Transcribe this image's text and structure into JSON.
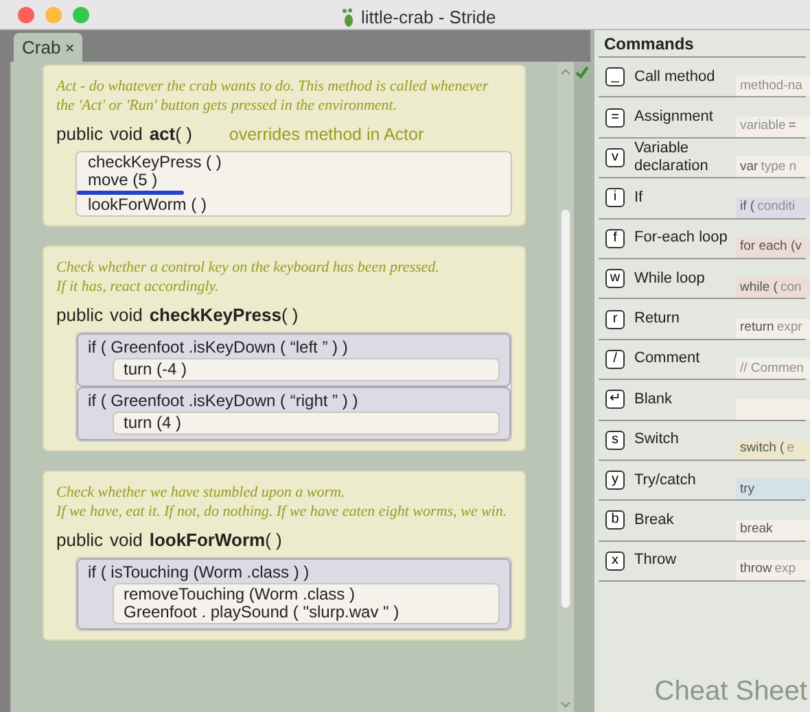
{
  "window": {
    "title": "little-crab - Stride"
  },
  "tabs": [
    {
      "label": "Crab",
      "close": "×",
      "selected": true
    }
  ],
  "methods": [
    {
      "comment": [
        "Act - do whatever the crab wants to do. This method is called whenever",
        "the 'Act' or 'Run' button gets pressed in the environment."
      ],
      "modifiers": [
        "public",
        "void"
      ],
      "name": "act",
      "params": "( )",
      "note": "overrides method in Actor",
      "body": [
        {
          "kind": "call",
          "text": "checkKeyPress ( )",
          "cursor_after": false
        },
        {
          "kind": "call",
          "text": "move (5 )",
          "cursor_after": true
        },
        {
          "kind": "call",
          "text": "lookForWorm ( )",
          "cursor_after": false
        }
      ]
    },
    {
      "comment": [
        "Check whether a control key on the keyboard has been pressed.",
        "If it has, react accordingly."
      ],
      "modifiers": [
        "public",
        "void"
      ],
      "name": "checkKeyPress",
      "params": "( )",
      "body": [
        {
          "kind": "if",
          "condition": "if ( Greenfoot .isKeyDown ( “left ” ) )",
          "body": [
            "turn (-4 )"
          ]
        },
        {
          "kind": "if",
          "condition": "if ( Greenfoot .isKeyDown ( “right ” ) )",
          "body": [
            "turn (4 )"
          ]
        }
      ]
    },
    {
      "comment": [
        "Check whether we have stumbled upon a worm.",
        "If we have, eat it. If not, do nothing. If we have eaten eight worms, we win."
      ],
      "modifiers": [
        "public",
        "void"
      ],
      "name": "lookForWorm",
      "params": "( )",
      "body": [
        {
          "kind": "if",
          "condition": "if ( isTouching (Worm .class ) )",
          "body": [
            "removeTouching (Worm .class )",
            "Greenfoot . playSound ( \"slurp.wav \" )"
          ]
        }
      ]
    }
  ],
  "commands": {
    "title": "Commands",
    "footer": "Cheat Sheet",
    "items": [
      {
        "key": "_",
        "label": "Call method",
        "color": "#f3efe8",
        "preview": [
          {
            "kind": "hint",
            "text": "method-na"
          }
        ]
      },
      {
        "key": "=",
        "label": "Assignment",
        "color": "#f3efe8",
        "preview": [
          {
            "kind": "hint",
            "text": "variable"
          },
          {
            "kind": "keyword",
            "text": "="
          }
        ]
      },
      {
        "key": "v",
        "label": "Variable declaration",
        "color": "#f3efe8",
        "preview": [
          {
            "kind": "keyword",
            "text": "var"
          },
          {
            "kind": "hint",
            "text": "type n"
          }
        ]
      },
      {
        "key": "i",
        "label": "If",
        "color": "#dcdbe6",
        "preview": [
          {
            "kind": "keyword",
            "text": "if ("
          },
          {
            "kind": "hint",
            "text": "conditi"
          }
        ]
      },
      {
        "key": "f",
        "label": "For-each loop",
        "color": "#ecdcd6",
        "preview": [
          {
            "kind": "keyword",
            "text": "for each (v"
          }
        ]
      },
      {
        "key": "w",
        "label": "While loop",
        "color": "#ecdcd6",
        "preview": [
          {
            "kind": "keyword",
            "text": "while ("
          },
          {
            "kind": "hint",
            "text": "con"
          }
        ]
      },
      {
        "key": "r",
        "label": "Return",
        "color": "#f3efe8",
        "preview": [
          {
            "kind": "keyword",
            "text": "return"
          },
          {
            "kind": "hint",
            "text": "expr"
          }
        ]
      },
      {
        "key": "/",
        "label": "Comment",
        "color": "#f3efe8",
        "preview": [
          {
            "kind": "hint",
            "text": "//  Commen"
          }
        ]
      },
      {
        "key": "↵",
        "label": "Blank",
        "color": "#f3efe8"
      },
      {
        "key": "s",
        "label": "Switch",
        "color": "#ece7cc",
        "preview": [
          {
            "kind": "keyword",
            "text": "switch ("
          },
          {
            "kind": "hint",
            "text": "e"
          }
        ]
      },
      {
        "key": "y",
        "label": "Try/catch",
        "color": "#d4e1e6",
        "preview": [
          {
            "kind": "keyword",
            "text": "try"
          }
        ]
      },
      {
        "key": "b",
        "label": "Break",
        "color": "#f3efe8",
        "preview": [
          {
            "kind": "keyword",
            "text": "break"
          }
        ]
      },
      {
        "key": "x",
        "label": "Throw",
        "color": "#f3efe8",
        "preview": [
          {
            "kind": "keyword",
            "text": "throw"
          },
          {
            "kind": "hint",
            "text": "exp"
          }
        ]
      }
    ]
  }
}
